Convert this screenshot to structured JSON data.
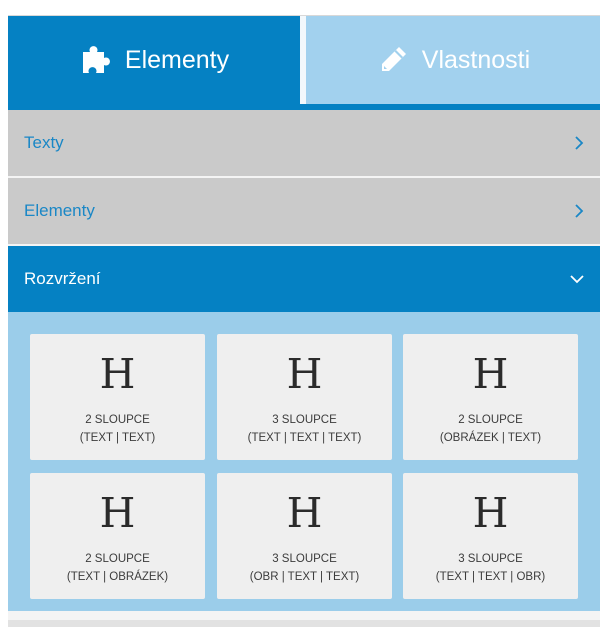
{
  "tabs": [
    {
      "label": "Elementy",
      "icon": "puzzle-icon",
      "active": true
    },
    {
      "label": "Vlastnosti",
      "icon": "pencil-icon",
      "active": false
    }
  ],
  "accordion": [
    {
      "label": "Texty",
      "state": "collapsed",
      "icon": "chevron-right-icon"
    },
    {
      "label": "Elementy",
      "state": "collapsed",
      "icon": "chevron-right-icon"
    },
    {
      "label": "Rozvržení",
      "state": "expanded",
      "icon": "chevron-down-icon"
    }
  ],
  "layouts": [
    {
      "glyph": "H",
      "line1": "2 SLOUPCE",
      "line2": "(TEXT | TEXT)"
    },
    {
      "glyph": "H",
      "line1": "3 SLOUPCE",
      "line2": "(TEXT | TEXT | TEXT)"
    },
    {
      "glyph": "H",
      "line1": "2 SLOUPCE",
      "line2": "(OBRÁZEK | TEXT)"
    },
    {
      "glyph": "H",
      "line1": "2 SLOUPCE",
      "line2": "(TEXT | OBRÁZEK)"
    },
    {
      "glyph": "H",
      "line1": "3 SLOUPCE",
      "line2": "(OBR | TEXT | TEXT)"
    },
    {
      "glyph": "H",
      "line1": "3 SLOUPCE",
      "line2": "(TEXT | TEXT | OBR)"
    }
  ],
  "colors": {
    "accent": "#0581c3",
    "tab_inactive": "#a2d1ee",
    "accordion_collapsed": "#cacaca",
    "accordion_label": "#1a87c6",
    "grid_background": "#9bcdea",
    "card_background": "#efefef"
  }
}
